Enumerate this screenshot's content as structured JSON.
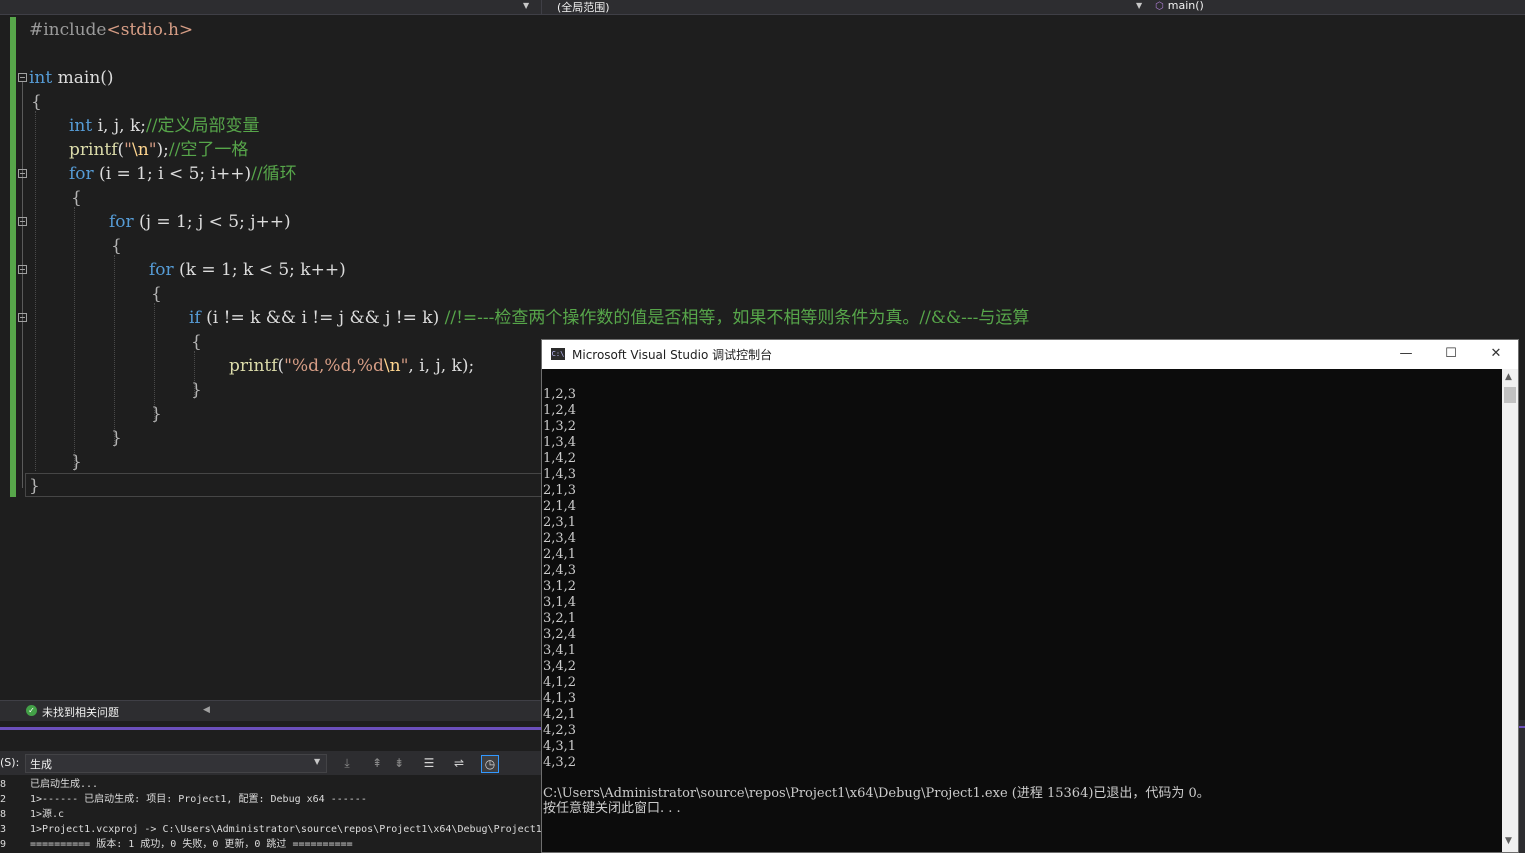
{
  "navbar": {
    "scope": "(全局范围)",
    "function": "main()"
  },
  "editor": {
    "lines": {
      "l1_pp": "#include",
      "l1_hdr": "<stdio.h>",
      "l3_kw": "int",
      "l3_rest": " main()",
      "l4": "{",
      "l5_kw": "int",
      "l5_rest": " i, j, k;",
      "l5_cm": "//定义局部变量",
      "l6_fn": "printf",
      "l6_p1": "(",
      "l6_str1": "\"",
      "l6_esc": "\\n",
      "l6_str2": "\"",
      "l6_p2": ");",
      "l6_cm": "//空了一格",
      "l7_kw": "for",
      "l7_rest": " (i = 1; i < 5; i++)",
      "l7_cm": "//循环",
      "l8": "{",
      "l9_kw": "for",
      "l9_rest": " (j = 1; j < 5; j++)",
      "l10": "{",
      "l11_kw": "for",
      "l11_rest": " (k = 1; k < 5; k++)",
      "l12": "{",
      "l13_kw": "if",
      "l13_rest": " (i != k && i != j && j != k) ",
      "l13_cm": "//!=---检查两个操作数的值是否相等，如果不相等则条件为真。//&&---与运算",
      "l14": "{",
      "l15_fn": "printf",
      "l15_p1": "(",
      "l15_str": "\"%d,%d,%d",
      "l15_esc": "\\n",
      "l15_str2": "\"",
      "l15_rest": ", i, j, k);",
      "l16": "}",
      "l17": "}",
      "l18": "}",
      "l19": "}",
      "l20": "}"
    }
  },
  "status": {
    "message": "未找到相关问题"
  },
  "output": {
    "label": "(S):",
    "source": "生成",
    "lines": [
      {
        "ln": "8",
        "text": "已启动生成..."
      },
      {
        "ln": "2",
        "text": "1>------ 已启动生成: 项目: Project1, 配置: Debug x64 ------"
      },
      {
        "ln": "8",
        "text": "1>源.c"
      },
      {
        "ln": "3",
        "text": "1>Project1.vcxproj -> C:\\Users\\Administrator\\source\\repos\\Project1\\x64\\Debug\\Project1"
      },
      {
        "ln": "9",
        "text": "========== 版本: 1 成功，0 失败，0 更新，0 跳过 =========="
      }
    ]
  },
  "console": {
    "title": "Microsoft Visual Studio 调试控制台",
    "app_icon": "C:\\",
    "results": [
      "1,2,3",
      "1,2,4",
      "1,3,2",
      "1,3,4",
      "1,4,2",
      "1,4,3",
      "2,1,3",
      "2,1,4",
      "2,3,1",
      "2,3,4",
      "2,4,1",
      "2,4,3",
      "3,1,2",
      "3,1,4",
      "3,2,1",
      "3,2,4",
      "3,4,1",
      "3,4,2",
      "4,1,2",
      "4,1,3",
      "4,2,1",
      "4,2,3",
      "4,3,1",
      "4,3,2"
    ],
    "exit_message": "C:\\Users\\Administrator\\source\\repos\\Project1\\x64\\Debug\\Project1.exe (进程 15364)已退出，代码为 0。",
    "press_key": "按任意键关闭此窗口. . ."
  }
}
